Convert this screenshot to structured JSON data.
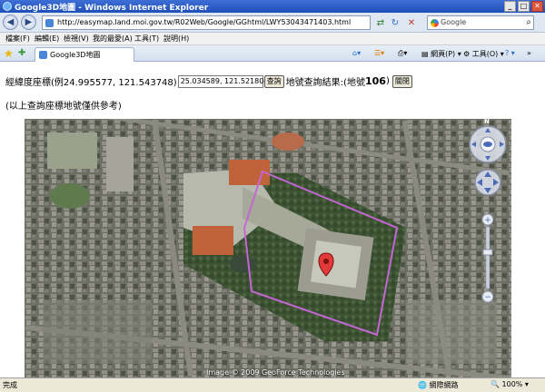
{
  "window": {
    "title": "Google3D地圖 - Windows Internet Explorer"
  },
  "address_bar": {
    "url": "http://easymap.land.moi.gov.tw/R02Web/Google/GGhtml/LWY53043471403.html",
    "search_placeholder": "Google"
  },
  "menu": [
    "檔案(F)",
    "編輯(E)",
    "檢視(V)",
    "我的最愛(A)",
    "工具(T)",
    "說明(H)"
  ],
  "tab": {
    "label": "Google3D地圖"
  },
  "command_bar": {
    "page_label": "網頁(P)",
    "tools_label": "工具(O)"
  },
  "page": {
    "coord_label": "經緯度座標(例24.995577, 121.543748)",
    "coord_value": "25.034589, 121.521804",
    "query_button": "查詢",
    "result_prefix": "地號查詢結果:(地號",
    "result_number": "106",
    "result_suffix": ")",
    "close_button": "關閉",
    "note": "(以上查詢座標地號僅供參考)"
  },
  "map": {
    "copyright": "Image © 2009 GeoForce Technologies",
    "compass_label": "N"
  },
  "status_bar": {
    "status": "完成",
    "zone": "網際網路",
    "zoom": "100%"
  }
}
